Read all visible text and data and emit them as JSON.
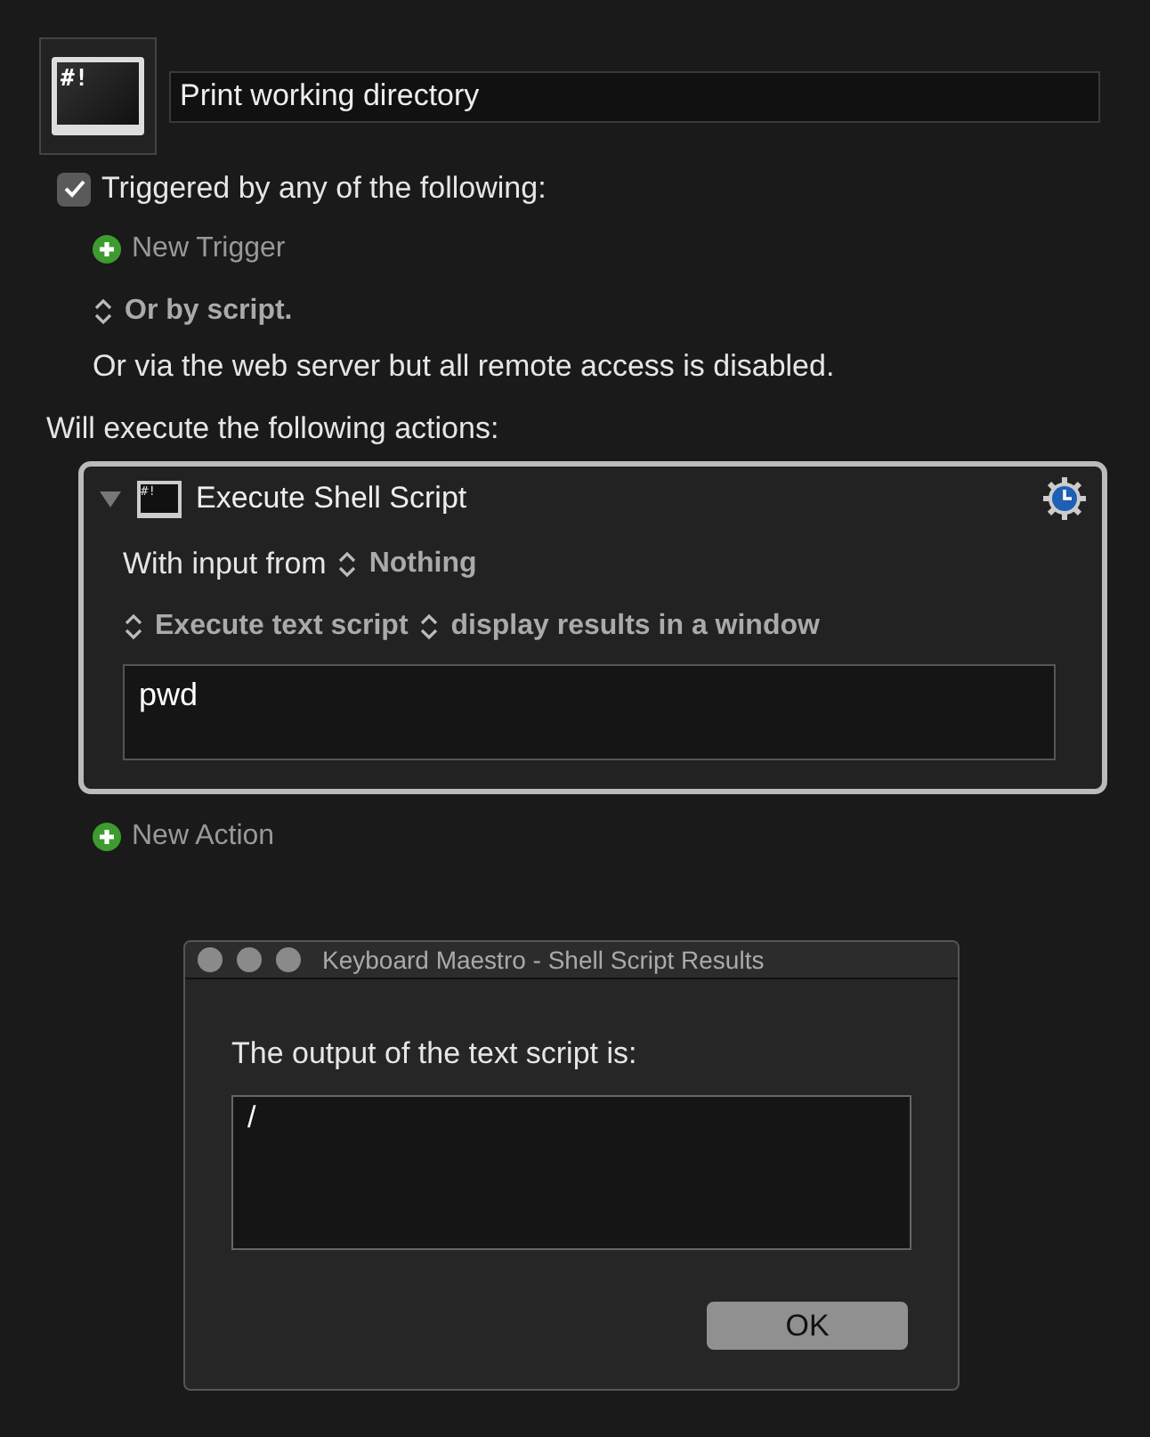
{
  "macro": {
    "icon_text": "#!",
    "name": "Print working directory"
  },
  "triggers": {
    "checked": true,
    "label": "Triggered by any of the following:",
    "new_trigger": "New Trigger",
    "script_option": "Or by script.",
    "web_note": "Or via the web server but all remote access is disabled."
  },
  "actions_heading": "Will execute the following actions:",
  "action": {
    "expanded": true,
    "icon_text": "#!",
    "title": "Execute Shell Script",
    "input_label": "With input from",
    "input_value": "Nothing",
    "mode": "Execute text script",
    "output": "display results in a window",
    "script": "pwd"
  },
  "new_action": "New Action",
  "dialog": {
    "title": "Keyboard Maestro - Shell Script Results",
    "message": "The output of the text script is:",
    "output": "/",
    "buttons": [
      "OK"
    ]
  }
}
